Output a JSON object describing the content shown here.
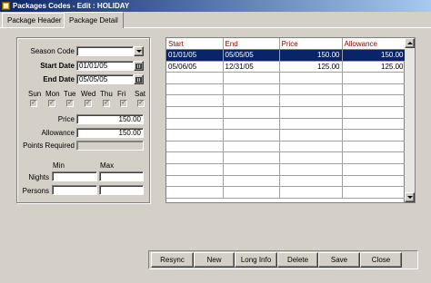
{
  "window": {
    "title": "Packages Codes - Edit : HOLIDAY"
  },
  "tabs": [
    {
      "label": "Package Header",
      "active": false
    },
    {
      "label": "Package Detail",
      "active": true
    }
  ],
  "form": {
    "season_code": {
      "label": "Season Code",
      "value": ""
    },
    "start_date": {
      "label": "Start Date",
      "value": "01/01/05"
    },
    "end_date": {
      "label": "End Date",
      "value": "05/05/05"
    },
    "days": [
      {
        "label": "Sun",
        "checked": true
      },
      {
        "label": "Mon",
        "checked": true
      },
      {
        "label": "Tue",
        "checked": true
      },
      {
        "label": "Wed",
        "checked": true
      },
      {
        "label": "Thu",
        "checked": true
      },
      {
        "label": "Fri",
        "checked": true
      },
      {
        "label": "Sat",
        "checked": true
      }
    ],
    "price": {
      "label": "Price",
      "value": "150.00"
    },
    "allowance": {
      "label": "Allowance",
      "value": "150.00"
    },
    "points_required": {
      "label": "Points Required",
      "value": ""
    },
    "min_label": "Min",
    "max_label": "Max",
    "nights": {
      "label": "Nights",
      "min": "",
      "max": ""
    },
    "persons": {
      "label": "Persons",
      "min": "",
      "max": ""
    }
  },
  "grid": {
    "columns": [
      "Start",
      "End",
      "Price",
      "Allowance"
    ],
    "rows": [
      {
        "start": "01/01/05",
        "end": "05/05/05",
        "price": "150.00",
        "allowance": "150.00",
        "selected": true
      },
      {
        "start": "05/06/05",
        "end": "12/31/05",
        "price": "125.00",
        "allowance": "125.00",
        "selected": false
      }
    ]
  },
  "buttons": {
    "resync": "Resync",
    "new": "New",
    "long_info": "Long Info",
    "delete": "Delete",
    "save": "Save",
    "close": "Close"
  },
  "colors": {
    "titlebar": "#0a246a",
    "selection": "#0a246a",
    "header_text": "#8b0000",
    "window_bg": "#d4d0c8"
  }
}
